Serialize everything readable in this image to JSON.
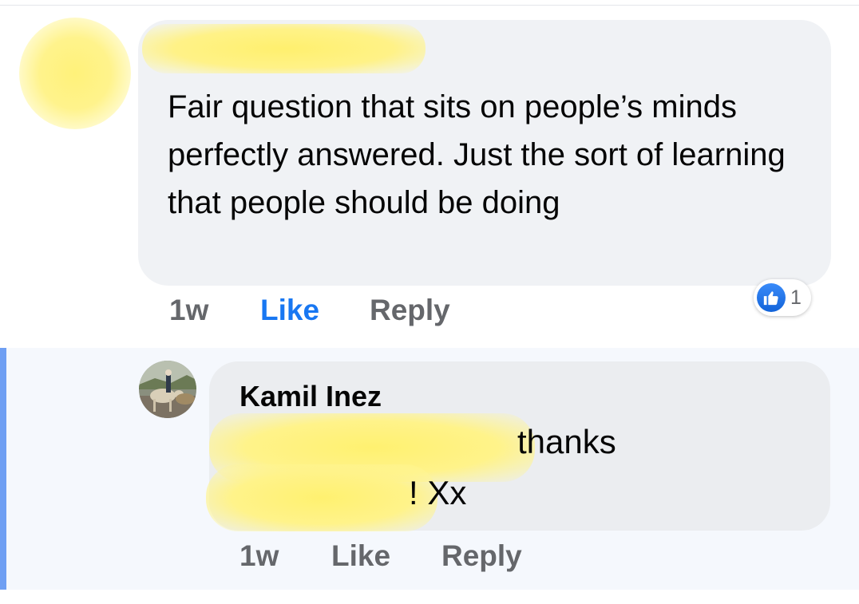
{
  "comment1": {
    "text": "Fair question that sits on people’s minds perfectly answered. Just the sort of learning that people should be doing",
    "time": "1w",
    "like_label": "Like",
    "reply_label": "Reply",
    "reaction_count": "1",
    "like_color": "#1877f2"
  },
  "reply": {
    "author": "Kamil Inez",
    "text_line1": "thanks",
    "text_line2": "! Xx",
    "time": "1w",
    "like_label": "Like",
    "reply_label": "Reply",
    "thread_bar_color": "#6f9ff3"
  },
  "icons": {
    "reaction": "thumbs-up-icon"
  }
}
